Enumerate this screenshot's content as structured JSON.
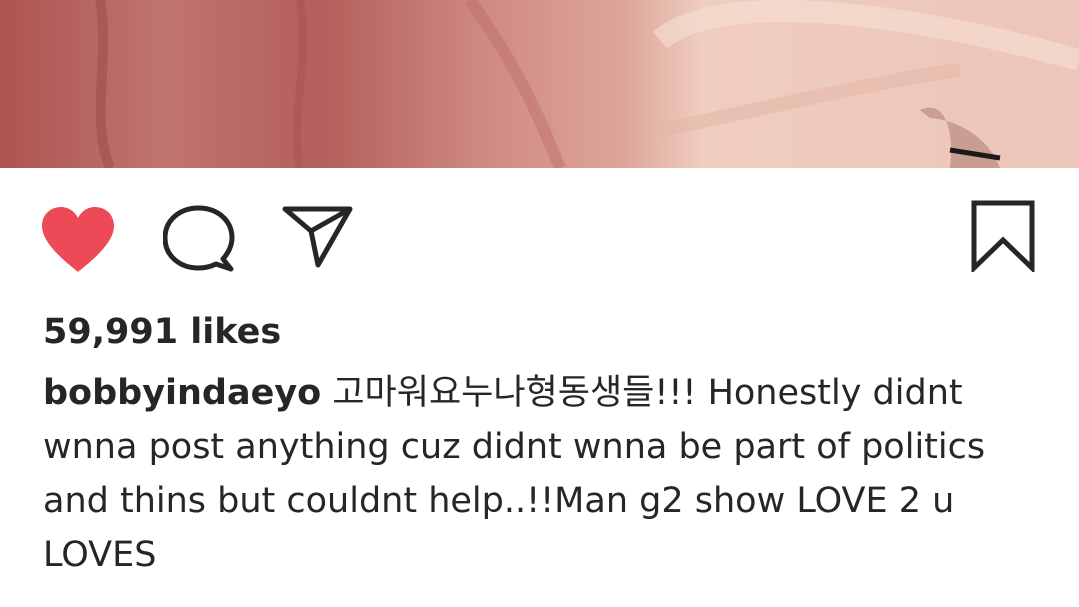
{
  "post": {
    "image": {
      "description_colors": {
        "left": "#b35a56",
        "right": "#ecc8ba"
      }
    },
    "actions": {
      "like_icon": "heart-filled-icon",
      "like_color": "#ed4956",
      "comment_icon": "comment-bubble-icon",
      "share_icon": "paper-plane-icon",
      "save_icon": "bookmark-icon",
      "liked": true
    },
    "likes_text": "59,991 likes",
    "caption": {
      "username": "bobbyindaeyo",
      "text": "고마워요누나형동생들!!! Honestly didnt wnna post anything cuz didnt wnna be part of politics and thins but couldnt help..!!Man g2 show LOVE 2 u LOVES"
    }
  }
}
